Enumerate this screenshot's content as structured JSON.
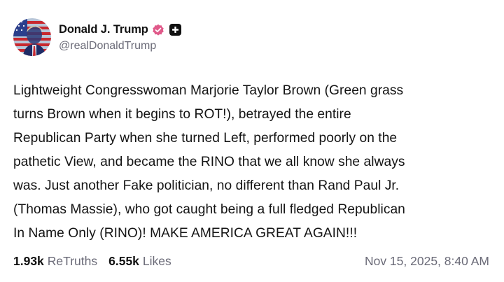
{
  "post": {
    "author": {
      "display_name": "Donald J. Trump",
      "handle": "@realDonaldTrump",
      "avatar_icon": "user-avatar-flag-portrait",
      "verified_icon": "verified-badge-icon",
      "plus_icon": "plus-badge-icon"
    },
    "text": "Lightweight Congresswoman Marjorie Taylor Brown (Green grass\nturns Brown when it begins to ROT!), betrayed the entire\nRepublican Party when she turned Left, performed poorly on the\npathetic View, and became the RINO that we all know she always\nwas. Just another Fake politician, no different than Rand Paul Jr.\n(Thomas Massie), who got caught being a full fledged Republican\nIn Name Only (RINO)! MAKE AMERICA GREAT AGAIN!!!",
    "stats": {
      "retruths_count": "1.93k",
      "retruths_label": "ReTruths",
      "likes_count": "6.55k",
      "likes_label": "Likes"
    },
    "timestamp": "Nov 15, 2025, 8:40 AM"
  },
  "colors": {
    "text_primary": "#111111",
    "text_secondary": "#6b6b78",
    "verified_badge": "#e05a8a",
    "background": "#ffffff"
  }
}
